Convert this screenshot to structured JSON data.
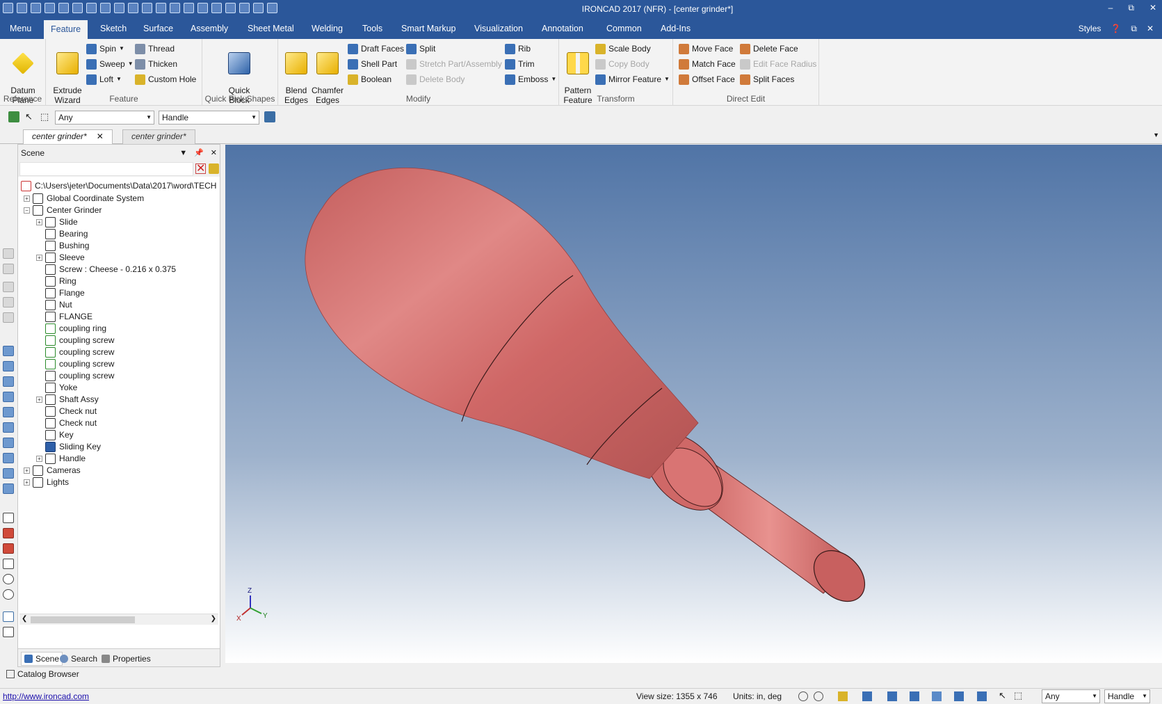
{
  "window": {
    "title": "IRONCAD 2017 (NFR) - [center grinder*]",
    "min": "–",
    "restore": "⧉",
    "close": "✕"
  },
  "tabs": [
    "Menu",
    "Feature",
    "Sketch",
    "Surface",
    "Assembly",
    "Sheet Metal",
    "Welding",
    "Tools",
    "Smart Markup",
    "Visualization",
    "Annotation",
    "Common",
    "Add-Ins"
  ],
  "styles_label": "Styles",
  "ribbon": {
    "reference": {
      "label": "Reference",
      "datum_plane": "Datum\nPlane"
    },
    "feature": {
      "label": "Feature",
      "extrude": "Extrude\nWizard",
      "spin": "Spin",
      "sweep": "Sweep",
      "loft": "Loft",
      "thread": "Thread",
      "thicken": "Thicken",
      "custom_hole": "Custom Hole"
    },
    "quick_pick": {
      "label": "Quick Pick Shapes",
      "quick_block": "Quick\nBlock"
    },
    "modify": {
      "label": "Modify",
      "blend": "Blend\nEdges",
      "chamfer": "Chamfer\nEdges",
      "draft": "Draft Faces",
      "shell": "Shell Part",
      "boolean": "Boolean",
      "split": "Split",
      "stretch": "Stretch Part/Assembly",
      "delete_body": "Delete Body",
      "rib": "Rib",
      "trim": "Trim",
      "emboss": "Emboss"
    },
    "transform": {
      "label": "Transform",
      "pattern": "Pattern\nFeature",
      "scale": "Scale Body",
      "copy": "Copy Body",
      "mirror": "Mirror Feature"
    },
    "direct_edit": {
      "label": "Direct Edit",
      "move_face": "Move Face",
      "match_face": "Match Face",
      "offset_face": "Offset Face",
      "delete_face": "Delete Face",
      "edit_radius": "Edit Face Radius",
      "split_faces": "Split Faces"
    }
  },
  "selection": {
    "filter": "Any",
    "target": "Handle"
  },
  "doc_tabs": [
    "center grinder*",
    "center grinder*"
  ],
  "scene": {
    "title": "Scene",
    "root": "C:\\Users\\jeter\\Documents\\Data\\2017\\word\\TECH",
    "items": [
      {
        "label": "Global Coordinate System",
        "level": 0,
        "exp": "+"
      },
      {
        "label": "Center Grinder",
        "level": 0,
        "exp": "−"
      },
      {
        "label": "Slide",
        "level": 1,
        "exp": "+"
      },
      {
        "label": "Bearing",
        "level": 1,
        "exp": ""
      },
      {
        "label": "Bushing",
        "level": 1,
        "exp": ""
      },
      {
        "label": "Sleeve",
        "level": 1,
        "exp": "+"
      },
      {
        "label": "Screw : Cheese - 0.216 x 0.375",
        "level": 1,
        "exp": ""
      },
      {
        "label": "Ring",
        "level": 1,
        "exp": ""
      },
      {
        "label": "Flange",
        "level": 1,
        "exp": ""
      },
      {
        "label": "Nut",
        "level": 1,
        "exp": ""
      },
      {
        "label": "FLANGE",
        "level": 1,
        "exp": ""
      },
      {
        "label": "coupling ring",
        "level": 1,
        "exp": ""
      },
      {
        "label": "coupling screw",
        "level": 1,
        "exp": ""
      },
      {
        "label": "coupling screw",
        "level": 1,
        "exp": ""
      },
      {
        "label": "coupling screw",
        "level": 1,
        "exp": ""
      },
      {
        "label": "coupling screw",
        "level": 1,
        "exp": ""
      },
      {
        "label": "Yoke",
        "level": 1,
        "exp": ""
      },
      {
        "label": "Shaft Assy",
        "level": 1,
        "exp": "+"
      },
      {
        "label": "Check nut",
        "level": 1,
        "exp": ""
      },
      {
        "label": "Check nut",
        "level": 1,
        "exp": ""
      },
      {
        "label": "Key",
        "level": 1,
        "exp": ""
      },
      {
        "label": "Sliding Key",
        "level": 1,
        "exp": ""
      },
      {
        "label": "Handle",
        "level": 1,
        "exp": "+"
      },
      {
        "label": "Cameras",
        "level": 0,
        "exp": "+"
      },
      {
        "label": "Lights",
        "level": 0,
        "exp": "+"
      }
    ],
    "tabs": [
      "Scene",
      "Search",
      "Properties"
    ]
  },
  "catalog": "Catalog Browser",
  "status": {
    "url": "http://www.ironcad.com",
    "view_size": "View size: 1355 x  746",
    "units": "Units: in, deg",
    "filter": "Any",
    "target": "Handle"
  },
  "axis": {
    "x": "X",
    "y": "Y",
    "z": "Z"
  },
  "colors": {
    "accent": "#2b579a",
    "part": "#d06a68"
  }
}
